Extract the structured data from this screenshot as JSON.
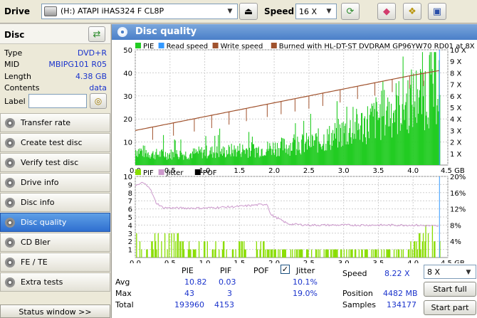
{
  "toolbar": {
    "drive_label": "Drive",
    "drive_value": "(H:)  ATAPI iHAS324   F CL8P",
    "speed_label": "Speed",
    "speed_value": "16 X",
    "icons": [
      "drive-icon",
      "eject-icon",
      "refresh-icon",
      "eraser-icon",
      "copy-icon",
      "save-icon"
    ]
  },
  "disc": {
    "title": "Disc",
    "rows": [
      {
        "key": "Type",
        "value": "DVD+R"
      },
      {
        "key": "MID",
        "value": "MBIPG101 R05"
      },
      {
        "key": "Length",
        "value": "4.38 GB"
      },
      {
        "key": "Contents",
        "value": "data"
      }
    ],
    "label_key": "Label",
    "label_value": ""
  },
  "nav": [
    {
      "label": "Transfer rate",
      "active": false
    },
    {
      "label": "Create test disc",
      "active": false
    },
    {
      "label": "Verify test disc",
      "active": false
    },
    {
      "label": "Drive info",
      "active": false
    },
    {
      "label": "Disc info",
      "active": false
    },
    {
      "label": "Disc quality",
      "active": true
    },
    {
      "label": "CD Bler",
      "active": false
    },
    {
      "label": "FE / TE",
      "active": false
    },
    {
      "label": "Extra tests",
      "active": false
    }
  ],
  "status_window": "Status window >>",
  "main_title": "Disc quality",
  "colors": {
    "pie": "#22cc22",
    "read_speed": "#3399ff",
    "write_speed": "#a0522d",
    "burned": "#a0522d",
    "pif": "#88dd00",
    "jitter": "#cc99cc",
    "pof": "#000000",
    "accent": "#4a7fc8"
  },
  "chart_data": [
    {
      "type": "bar",
      "legend": [
        {
          "name": "PIE",
          "color": "#22cc22"
        },
        {
          "name": "Read speed",
          "color": "#3399ff"
        },
        {
          "name": "Write speed",
          "color": "#a0522d"
        },
        {
          "name": "Burned with HL-DT-ST DVDRAM GP96YW70 RD01 at 8X",
          "color": "#a0522d"
        }
      ],
      "x_ticks": [
        "0.0",
        "0.5",
        "1.0",
        "1.5",
        "2.0",
        "2.5",
        "3.0",
        "3.5",
        "4.0",
        "4.5 GB"
      ],
      "y_ticks": [
        "10",
        "20",
        "30",
        "40",
        "50"
      ],
      "y2_ticks": [
        "1 X",
        "2 X",
        "3 X",
        "4 X",
        "5 X",
        "6 X",
        "7 X",
        "8 X",
        "9 X",
        "10 X"
      ],
      "xlim": [
        0,
        4.5
      ],
      "ylim": [
        0,
        50
      ],
      "y2lim": [
        0,
        10
      ],
      "grid": true,
      "legend_position": "top",
      "series": [
        {
          "name": "PIE",
          "x": [
            0.0,
            0.25,
            0.5,
            0.75,
            1.0,
            1.25,
            1.5,
            1.75,
            2.0,
            2.25,
            2.5,
            2.75,
            3.0,
            3.25,
            3.5,
            3.75,
            4.0,
            4.2,
            4.38
          ],
          "values": [
            7,
            5,
            5,
            5,
            6,
            6,
            7,
            7,
            8,
            9,
            10,
            12,
            15,
            18,
            22,
            26,
            30,
            34,
            38
          ]
        },
        {
          "name": "Write speed",
          "x": [
            0.0,
            0.5,
            1.0,
            1.5,
            2.0,
            2.5,
            3.0,
            3.5,
            4.0,
            4.38
          ],
          "values": [
            3.0,
            3.6,
            4.2,
            4.8,
            5.4,
            6.0,
            6.6,
            7.2,
            7.8,
            8.2
          ]
        }
      ]
    },
    {
      "type": "bar",
      "legend": [
        {
          "name": "PIF",
          "color": "#88dd00"
        },
        {
          "name": "Jitter",
          "color": "#cc99cc"
        },
        {
          "name": "POF",
          "color": "#000000"
        }
      ],
      "x_ticks": [
        "0.0",
        "0.5",
        "1.0",
        "1.5",
        "2.0",
        "2.5",
        "3.0",
        "3.5",
        "4.0",
        "4.5 GB"
      ],
      "y_ticks": [
        "1",
        "2",
        "3",
        "4",
        "5",
        "6",
        "7",
        "8",
        "9",
        "10"
      ],
      "y2_ticks": [
        "4%",
        "8%",
        "12%",
        "16%",
        "20%"
      ],
      "xlim": [
        0,
        4.5
      ],
      "ylim": [
        0,
        10
      ],
      "y2lim": [
        0,
        20
      ],
      "grid": true,
      "legend_position": "top",
      "series": [
        {
          "name": "PIF",
          "x": [
            0.05,
            0.3,
            0.6,
            0.9,
            1.1,
            1.4,
            1.7,
            1.9,
            2.3,
            2.7,
            3.1,
            3.5,
            3.8,
            4.05,
            4.2,
            4.35
          ],
          "values": [
            2,
            2,
            2,
            1,
            2,
            1,
            2,
            1,
            1,
            1,
            1,
            1,
            1,
            2,
            3,
            3
          ]
        },
        {
          "name": "Jitter",
          "x": [
            0.0,
            0.1,
            0.2,
            0.3,
            0.4,
            0.6,
            1.0,
            1.5,
            1.9,
            1.95,
            2.2,
            2.5,
            3.0,
            3.5,
            4.0,
            4.38
          ],
          "values": [
            17.5,
            18.5,
            17.5,
            13.5,
            12.3,
            12.2,
            12.2,
            12.6,
            13.2,
            10.6,
            8.3,
            8.0,
            8.0,
            8.0,
            8.0,
            7.7
          ]
        }
      ]
    }
  ],
  "stats": {
    "headers": {
      "pie": "PIE",
      "pif": "PIF",
      "pof": "POF",
      "jitter": "Jitter"
    },
    "rows": [
      {
        "label": "Avg",
        "pie": "10.82",
        "pif": "0.03",
        "jitter": "10.1%"
      },
      {
        "label": "Max",
        "pie": "43",
        "pif": "3",
        "jitter": "19.0%"
      },
      {
        "label": "Total",
        "pie": "193960",
        "pif": "4153",
        "jitter": ""
      }
    ],
    "jitter_checked": true,
    "speed_label": "Speed",
    "speed_value": "8.22 X",
    "position_label": "Position",
    "position_value": "4482 MB",
    "samples_label": "Samples",
    "samples_value": "134177",
    "speed_select": "8 X",
    "start_full": "Start full",
    "start_part": "Start part"
  }
}
